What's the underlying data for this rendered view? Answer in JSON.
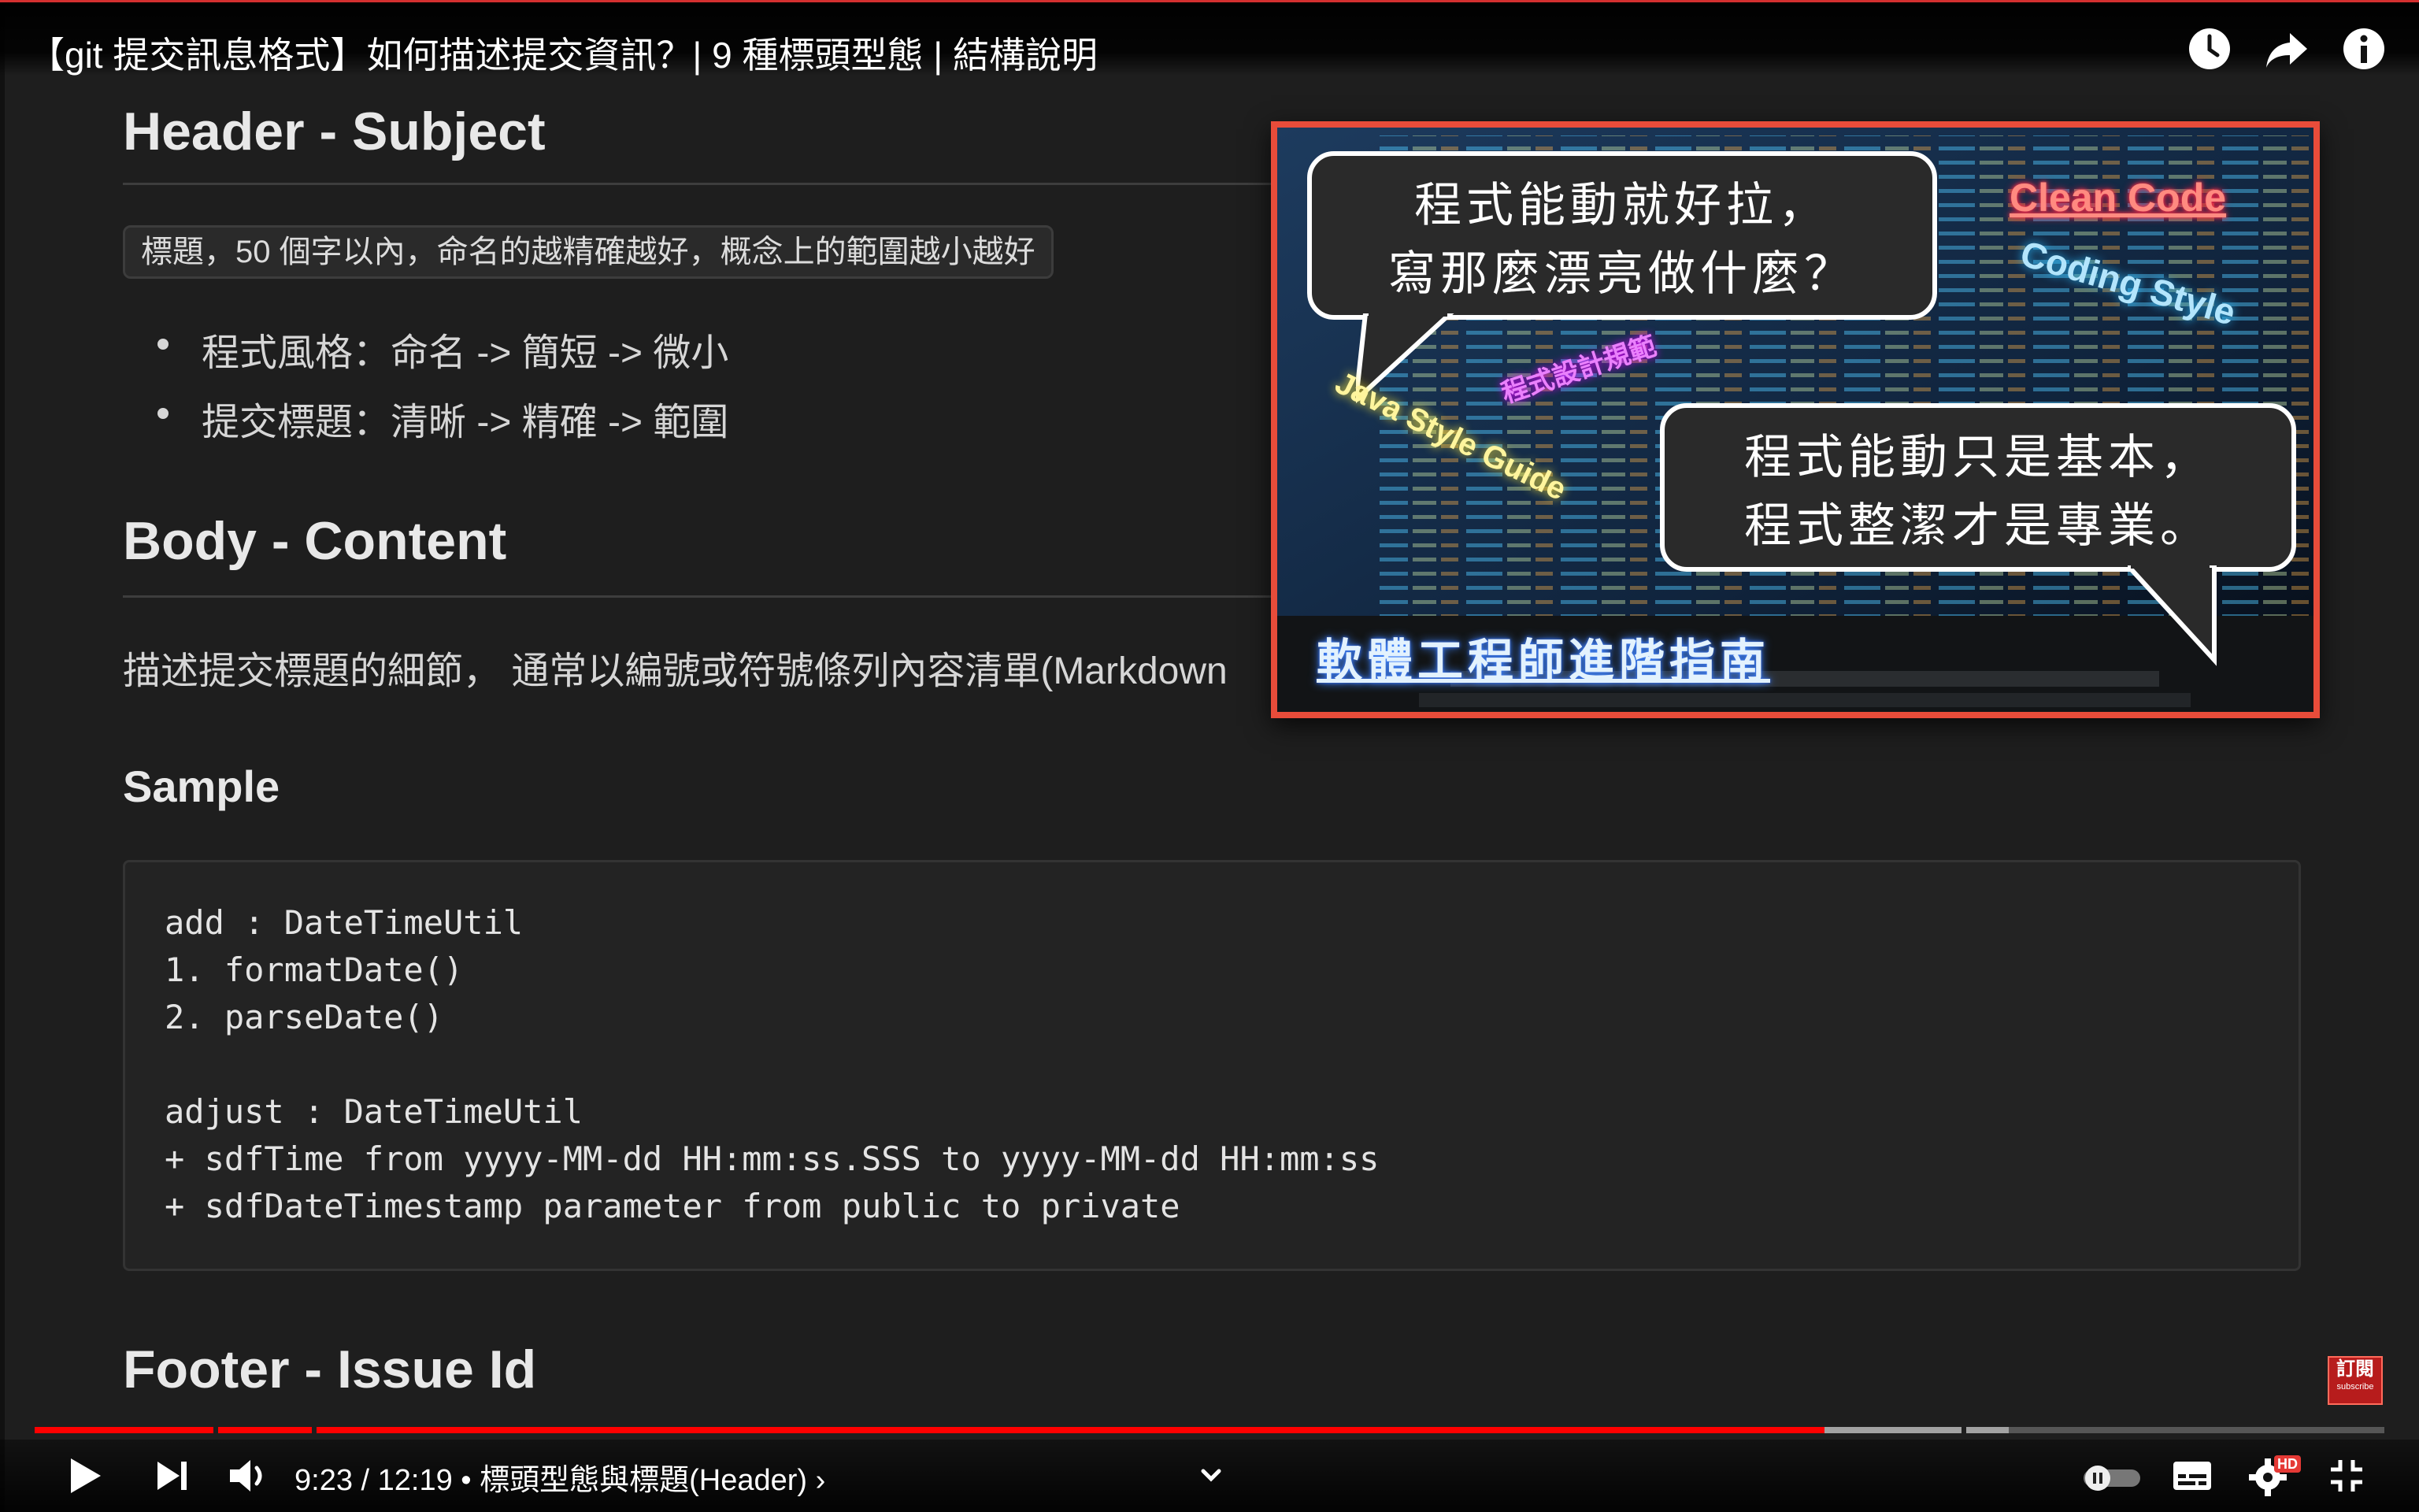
{
  "video": {
    "title": "【git 提交訊息格式】如何描述提交資訊？| 9 種標頭型態 | 結構說明"
  },
  "top_icons": [
    "clock-icon",
    "share-icon",
    "info-icon"
  ],
  "doc": {
    "header_subject": "Header - Subject",
    "subject_tag": "標題，50 個字以內，命名的越精確越好，概念上的範圍越小越好",
    "bullets": [
      "程式風格：命名 -> 簡短 -> 微小",
      "提交標題：清晰 -> 精確 -> 範圍"
    ],
    "body_content": "Body - Content",
    "body_text": "描述提交標題的細節， 通常以編號或符號條列內容清單(Markdown",
    "sample_heading": "Sample",
    "code_lines": [
      "add : DateTimeUtil",
      "1. formatDate()",
      "2. parseDate()",
      "",
      "adjust : DateTimeUtil",
      "+ sdfTime from yyyy-MM-dd HH:mm:ss.SSS to yyyy-MM-dd HH:mm:ss",
      "+ sdfDateTimestamp parameter from public to private"
    ],
    "footer_issue": "Footer - Issue Id"
  },
  "card": {
    "bubble1": [
      "程式能動就好拉，",
      "寫那麼漂亮做什麼？"
    ],
    "bubble2": [
      "程式能動只是基本，",
      "程式整潔才是專業。"
    ],
    "neon_clean_code": "Clean Code",
    "neon_coding_style": "Coding Style",
    "neon_java_guide": "Java Style Guide",
    "neon_design": "程式設計規範",
    "neon_title": "軟體工程師進階指南",
    "border_color": "#e84c3a"
  },
  "subscribe": {
    "zh": "訂閱",
    "en": "subscribe"
  },
  "player": {
    "time_text": "9:23 / 12:19 • 標頭型態與標題(Header) ›",
    "current_seconds": 563,
    "duration_seconds": 739,
    "buffered_fraction": 0.84,
    "chapter_fractions": [
      0.076,
      0.118,
      0.82
    ],
    "hd_badge": "HD",
    "autoplay_on": false,
    "progress_color": "#ff0000"
  }
}
